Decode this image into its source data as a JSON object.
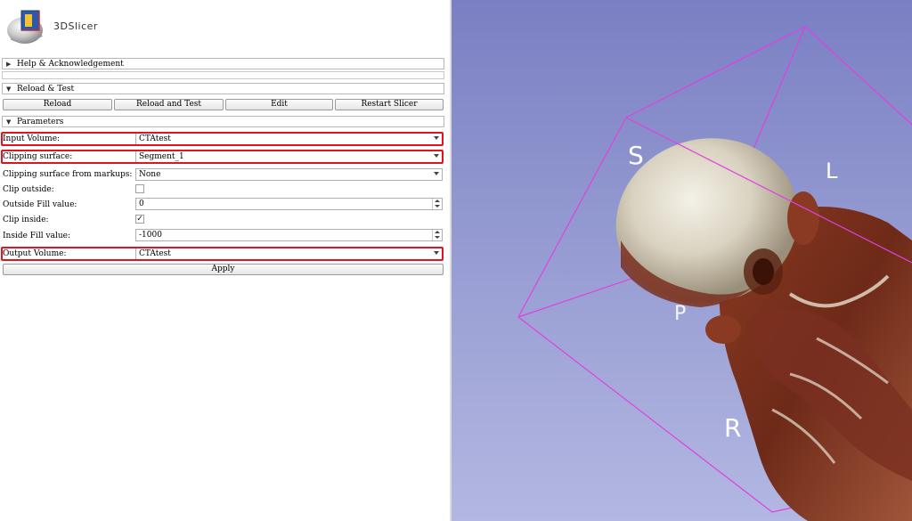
{
  "app": {
    "logo_text": "3DSlicer"
  },
  "sections": {
    "help": "Help & Acknowledgement",
    "reload_test": "Reload & Test",
    "parameters": "Parameters"
  },
  "reload_buttons": [
    "Reload",
    "Reload and Test",
    "Edit",
    "Restart Slicer"
  ],
  "params": {
    "input_volume": {
      "label": "Input Volume:",
      "value": "CTAtest"
    },
    "clipping_surface": {
      "label": "Clipping surface:",
      "value": "Segment_1"
    },
    "clipping_markups": {
      "label": "Clipping surface from markups:",
      "value": "None"
    },
    "clip_outside": {
      "label": "Clip outside:",
      "checked": false
    },
    "outside_fill": {
      "label": "Outside Fill value:",
      "value": "0"
    },
    "clip_inside": {
      "label": "Clip inside:",
      "checked": true,
      "mark": "✓"
    },
    "inside_fill": {
      "label": "Inside Fill value:",
      "value": "-1000"
    },
    "output_volume": {
      "label": "Output Volume:",
      "value": "CTAtest"
    },
    "apply": "Apply"
  },
  "view3d": {
    "orientation_labels": {
      "s": "S",
      "l": "L",
      "r": "R",
      "p": "P"
    },
    "background_top": "#7a7fc3",
    "background_bottom": "#b3b7e2",
    "bbox_color": "#e040e0"
  },
  "colors": {
    "highlight": "#e0141a"
  }
}
